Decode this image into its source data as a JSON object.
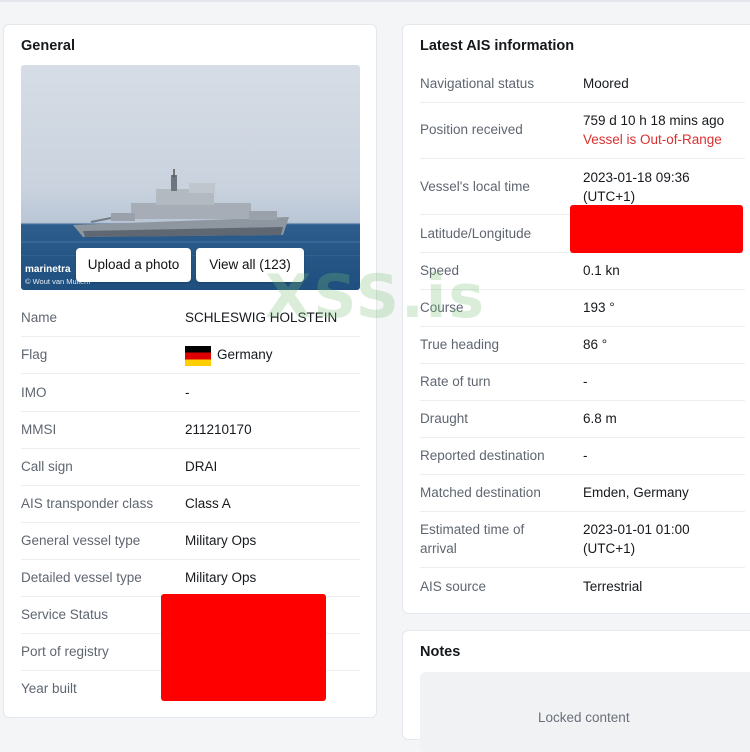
{
  "general": {
    "title": "General",
    "photo": {
      "upload_label": "Upload a photo",
      "view_all_label": "View all (123)",
      "brand": "marinetra",
      "credit": "© Wout van Mullem"
    },
    "rows": [
      {
        "label": "Name",
        "value": "SCHLESWIG HOLSTEIN"
      },
      {
        "label": "Flag",
        "value": "Germany"
      },
      {
        "label": "IMO",
        "value": "-"
      },
      {
        "label": "MMSI",
        "value": "211210170"
      },
      {
        "label": "Call sign",
        "value": "DRAI"
      },
      {
        "label": "AIS transponder class",
        "value": "Class A"
      },
      {
        "label": "General vessel type",
        "value": "Military Ops"
      },
      {
        "label": "Detailed vessel type",
        "value": "Military Ops"
      },
      {
        "label": "Service Status",
        "value": ""
      },
      {
        "label": "Port of registry",
        "value": ""
      },
      {
        "label": "Year built",
        "value": ""
      }
    ]
  },
  "ais": {
    "title": "Latest AIS information",
    "nav_status": {
      "label": "Navigational status",
      "value": "Moored"
    },
    "position_received": {
      "label": "Position received",
      "value": "759 d 10 h 18 mins ago",
      "warning": "Vessel is Out-of-Range"
    },
    "local_time": {
      "label": "Vessel's local time",
      "line1": "2023-01-18 09:36",
      "line2": "(UTC+1)"
    },
    "latlon": {
      "label": "Latitude/Longitude",
      "value": ""
    },
    "speed": {
      "label": "Speed",
      "value": "0.1 kn"
    },
    "course": {
      "label": "Course",
      "value": "193 °"
    },
    "heading": {
      "label": "True heading",
      "value": "86 °"
    },
    "rot": {
      "label": "Rate of turn",
      "value": "-"
    },
    "draught": {
      "label": "Draught",
      "value": "6.8 m"
    },
    "reported_dest": {
      "label": "Reported destination",
      "value": "-"
    },
    "matched_dest": {
      "label": "Matched destination",
      "value": "Emden, Germany"
    },
    "eta": {
      "label_line1": "Estimated time of",
      "label_line2": "arrival",
      "line1": "2023-01-01 01:00",
      "line2": "(UTC+1)"
    },
    "source": {
      "label": "AIS source",
      "value": "Terrestrial"
    }
  },
  "notes": {
    "title": "Notes",
    "locked": "Locked content"
  },
  "overlay": {
    "watermark": "XSS.is"
  },
  "colors": {
    "warning": "#d93131",
    "redaction": "#ff0000"
  }
}
